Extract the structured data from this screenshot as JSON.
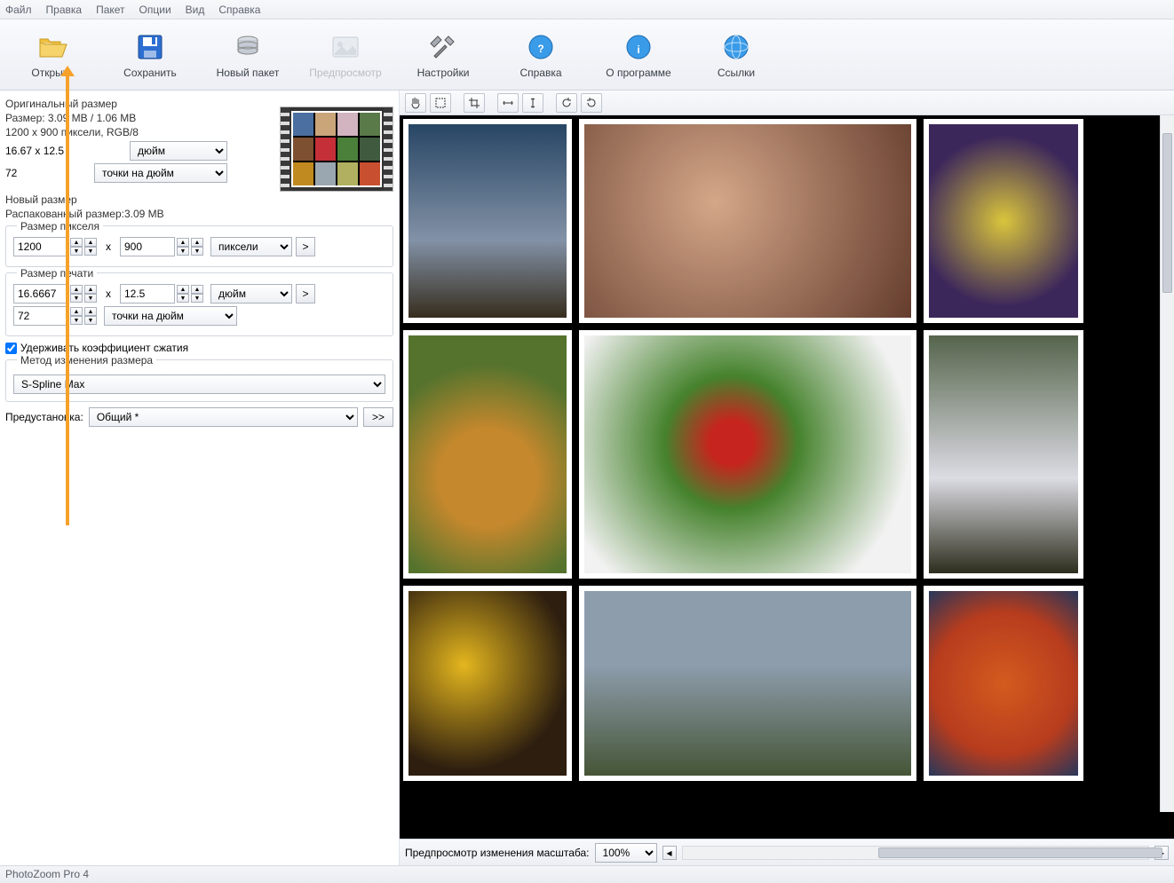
{
  "menubar": [
    "Файл",
    "Правка",
    "Пакет",
    "Опции",
    "Вид",
    "Справка"
  ],
  "toolbar": [
    {
      "key": "open",
      "label": "Открыть",
      "disabled": false
    },
    {
      "key": "save",
      "label": "Сохранить",
      "disabled": false
    },
    {
      "key": "new_batch",
      "label": "Новый пакет",
      "disabled": false
    },
    {
      "key": "preview",
      "label": "Предпросмотр",
      "disabled": true
    },
    {
      "key": "settings",
      "label": "Настройки",
      "disabled": false
    },
    {
      "key": "help",
      "label": "Справка",
      "disabled": false
    },
    {
      "key": "about",
      "label": "О программе",
      "disabled": false
    },
    {
      "key": "links",
      "label": "Ссылки",
      "disabled": false
    }
  ],
  "original": {
    "title": "Оригинальный размер",
    "size_line": "Размер: 3.09 MB / 1.06 MB",
    "pixels_line": "1200 x 900 пиксели, RGB/8",
    "print_dims": "16.67 x 12.5",
    "print_unit": "дюйм",
    "dpi": "72",
    "dpi_unit": "точки на дюйм"
  },
  "newsize": {
    "title": "Новый размер",
    "unpacked": "Распакованный размер:3.09 MB",
    "pixel_section": "Размер пикселя",
    "width": "1200",
    "height": "900",
    "px_unit": "пиксели",
    "print_section": "Размер печати",
    "pwidth": "16.6667",
    "pheight": "12.5",
    "print_unit": "дюйм",
    "pdpi": "72",
    "pdpi_unit": "точки на дюйм",
    "x_label": "x",
    "keep_ratio": "Удерживать коэффициент сжатия"
  },
  "method": {
    "title": "Метод изменения размера",
    "value": "S-Spline Max",
    "preset_label": "Предустановка:",
    "preset_value": "Общий *",
    "more": ">>"
  },
  "preview_bar": {
    "label": "Предпросмотр изменения масштаба:",
    "zoom": "100%"
  },
  "statusbar": "PhotoZoom Pro 4"
}
